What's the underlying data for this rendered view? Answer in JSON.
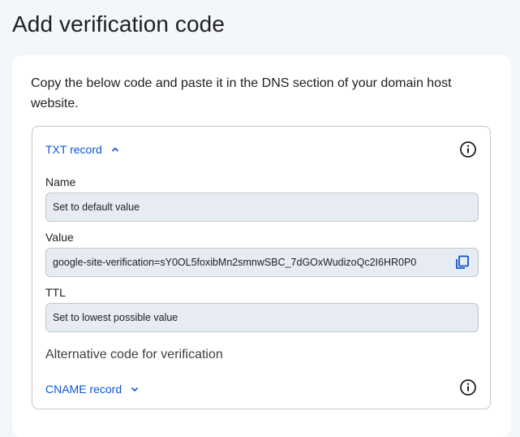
{
  "page": {
    "title": "Add verification code"
  },
  "card": {
    "instructions": "Copy the below code and paste it in the DNS section of your domain host website."
  },
  "txt_record": {
    "toggle_label": "TXT record",
    "expanded": true,
    "fields": {
      "name_label": "Name",
      "name_value": "Set to default value",
      "value_label": "Value",
      "value_value": "google-site-verification=sY0OL5foxibMn2smnwSBC_7dGOxWudizoQc2I6HR0P0",
      "ttl_label": "TTL",
      "ttl_value": "Set to lowest possible value"
    }
  },
  "alternative": {
    "heading": "Alternative code for verification",
    "cname_toggle_label": "CNAME record",
    "expanded": false
  },
  "icons": {
    "info": "info-icon",
    "copy": "copy-icon",
    "chevron_up": "chevron-up-icon",
    "chevron_down": "chevron-down-icon"
  },
  "colors": {
    "link_blue": "#0b57d0",
    "field_bg": "#e7ebf3",
    "page_bg": "#f3f6fb"
  }
}
